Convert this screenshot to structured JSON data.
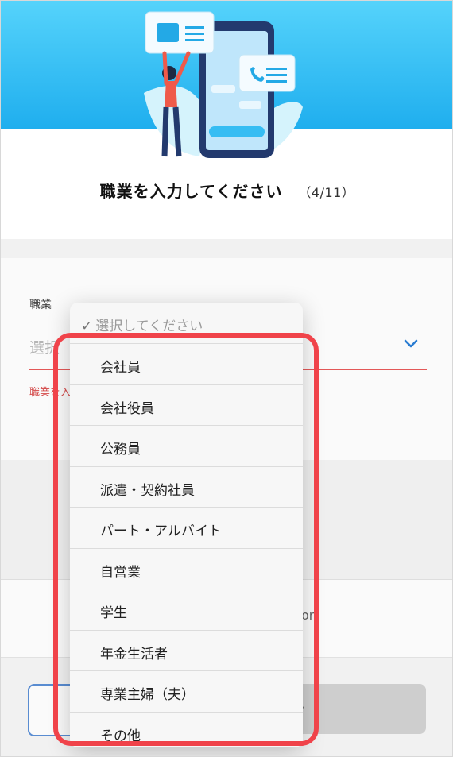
{
  "heading": {
    "title": "職業を入力してください",
    "step": "（4/11）"
  },
  "field": {
    "label": "職業",
    "value": "選択",
    "error": "職業を入"
  },
  "dropdown": {
    "placeholder": "選択してください",
    "options": [
      "会社員",
      "会社役員",
      "公務員",
      "派遣・契約社員",
      "パート・アルバイト",
      "自営業",
      "学生",
      "年金生活者",
      "専業主婦（夫）",
      "その他"
    ]
  },
  "background": {
    "fragment": "on"
  },
  "colors": {
    "hero": "#1faeee",
    "error": "#e85a5a",
    "highlight": "#f0434a"
  }
}
